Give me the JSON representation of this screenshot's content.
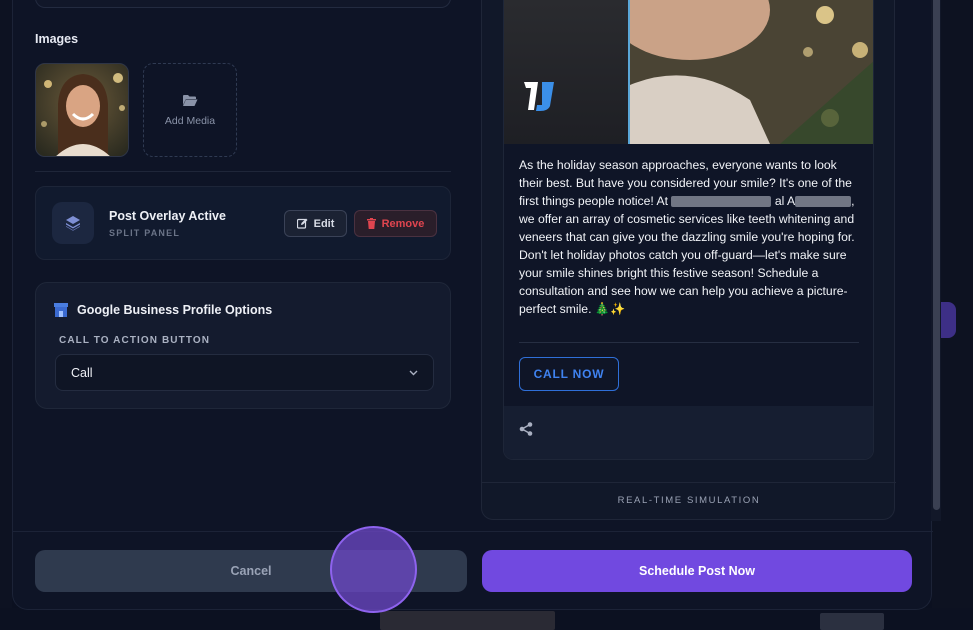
{
  "images_section": {
    "label": "Images",
    "add_media_label": "Add Media"
  },
  "overlay": {
    "title": "Post Overlay Active",
    "subtitle": "SPLIT PANEL",
    "edit_label": "Edit",
    "remove_label": "Remove"
  },
  "gbp": {
    "title": "Google Business Profile Options",
    "cta_label": "CALL TO ACTION BUTTON",
    "cta_selected": "Call"
  },
  "preview": {
    "post_text_1": "As the holiday season approaches, everyone wants to look their best. But have you considered your smile? It's one of the first things people notice! At ",
    "post_text_2": " al",
    "post_text_3": "A",
    "post_text_4": ", we offer an array of cosmetic services like teeth whitening and veneers that can give you the dazzling smile you're hoping for. Don't let holiday photos catch you off-guard—let's make sure your smile shines bright this festive season! Schedule a consultation and see how we can help you achieve a picture-perfect smile. 🎄✨",
    "cta_button": "CALL NOW",
    "sim_label": "REAL-TIME SIMULATION"
  },
  "footer": {
    "cancel_label": "Cancel",
    "schedule_label": "Schedule Post Now"
  },
  "colors": {
    "accent": "#7149e0",
    "danger": "#e0454f",
    "link": "#3f82f0"
  }
}
